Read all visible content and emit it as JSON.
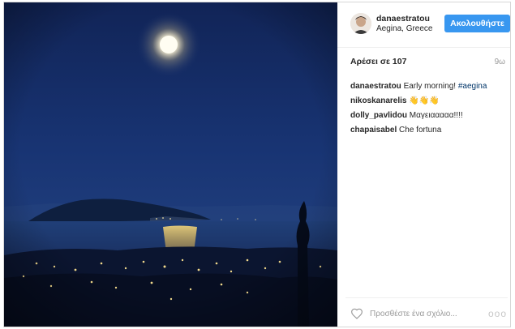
{
  "post": {
    "username": "danaestratou",
    "location": "Aegina, Greece",
    "follow_label": "Ακολουθήστε",
    "likes": "Αρέσει σε 107",
    "age": "9ω"
  },
  "comments": [
    {
      "user": "danaestratou",
      "text": "Early morning! ",
      "tag": "#aegina"
    },
    {
      "user": "nikoskanarelis",
      "text": "👋👋👋",
      "tag": ""
    },
    {
      "user": "dolly_pavlidou",
      "text": "Μαγειααααα!!!!",
      "tag": ""
    },
    {
      "user": "chapaisabel",
      "text": "Che fortuna",
      "tag": ""
    }
  ],
  "footer": {
    "comment_placeholder": "Προσθέστε ένα σχόλιο...",
    "more_label": "ooo"
  },
  "icons": [
    "heart-icon",
    "more-options-icon",
    "avatar"
  ],
  "colors": {
    "accent": "#3897f0",
    "hashtag": "#003569",
    "night_sky": "#152a5c"
  }
}
